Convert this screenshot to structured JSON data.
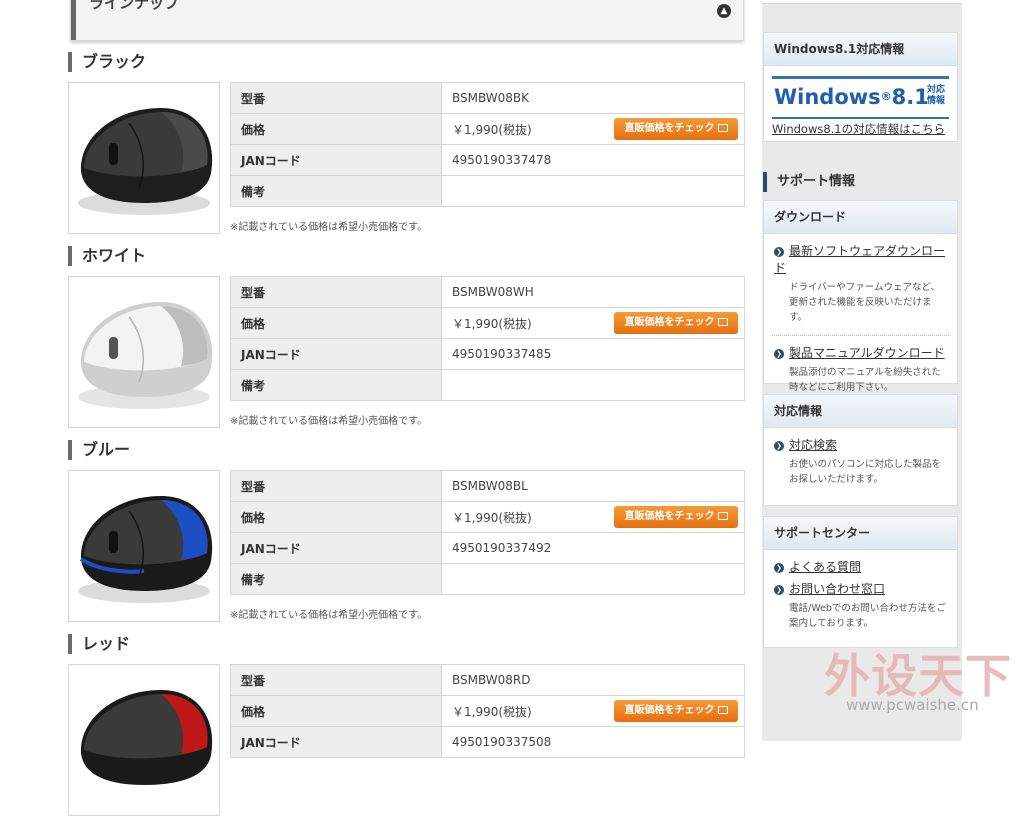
{
  "lineup": {
    "title": "ラインナップ"
  },
  "variants": [
    {
      "title": "ブラック",
      "model": "BSMBW08BK",
      "price": "￥1,990(税抜)",
      "jan": "4950190337478",
      "remarks": ""
    },
    {
      "title": "ホワイト",
      "model": "BSMBW08WH",
      "price": "￥1,990(税抜)",
      "jan": "4950190337485",
      "remarks": ""
    },
    {
      "title": "ブルー",
      "model": "BSMBW08BL",
      "price": "￥1,990(税抜)",
      "jan": "4950190337492",
      "remarks": ""
    },
    {
      "title": "レッド",
      "model": "BSMBW08RD",
      "price": "￥1,990(税抜)",
      "jan": "4950190337508",
      "remarks": ""
    }
  ],
  "labels": {
    "model": "型番",
    "price": "価格",
    "jan": "JANコード",
    "remarks": "備考",
    "direct_price_button": "直販価格をチェック",
    "note": "※記載されている価格は希望小売価格です。"
  },
  "mouse_colors": {
    "black": "#2a2a2a",
    "white": "#e8e8e8",
    "blue": "#1d4fc4",
    "red": "#c01818"
  },
  "sidebar": {
    "windows": {
      "head": "Windows8.1対応情報",
      "logo_text": "Windows",
      "logo_version": "8.1",
      "logo_registered": "®",
      "logo_taiou": "対応情報",
      "link": "Windows8.1の対応情報はこちら"
    },
    "support_title": "サポート情報",
    "download": {
      "head": "ダウンロード",
      "items": [
        {
          "link": "最新ソフトウェアダウンロード",
          "desc": "ドライバーやファームウェアなど、更新された機能を反映いただけます。"
        },
        {
          "link": "製品マニュアルダウンロード",
          "desc": "製品添付のマニュアルを紛失された時などにご利用下さい。"
        }
      ]
    },
    "compat": {
      "head": "対応情報",
      "items": [
        {
          "link": "対応検索",
          "desc": "お使いのパソコンに対応した製品をお探しいただけます。"
        }
      ]
    },
    "center": {
      "head": "サポートセンター",
      "links": [
        "よくある質問",
        "お問い合わせ窓口"
      ],
      "desc": "電話/Webでのお問い合わせ方法をご案内しております。"
    }
  },
  "watermark": {
    "cn": "外设天下",
    "url": "www.pcwaishe.cn"
  }
}
